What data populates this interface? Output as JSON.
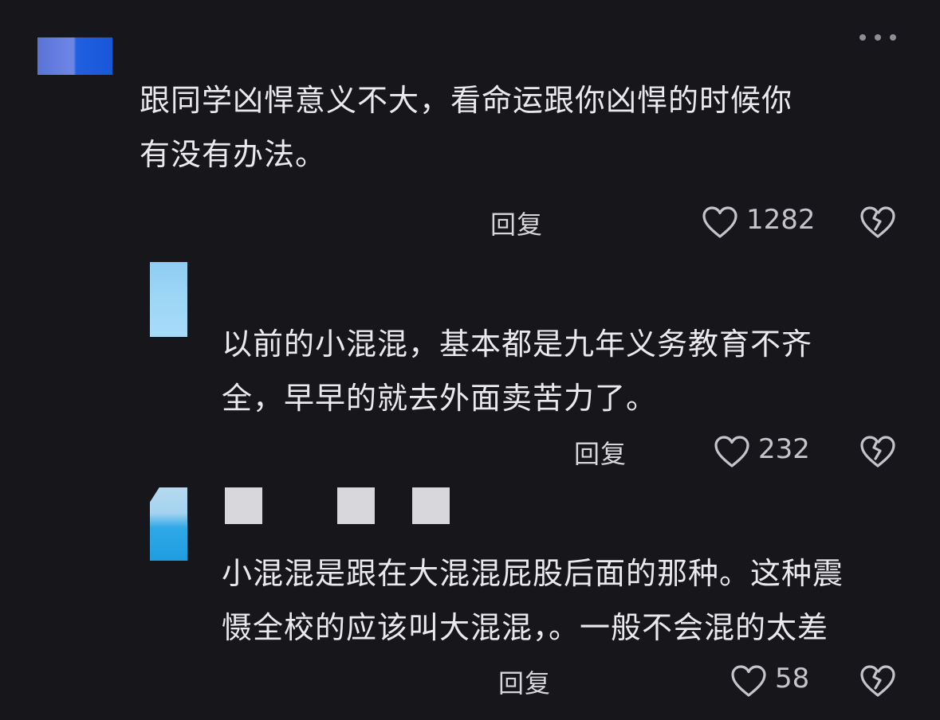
{
  "comments": [
    {
      "text_lines": [
        "跟同学凶悍意义不大，看命运跟你凶悍的时候你",
        "有没有办法。"
      ],
      "reply_label": "回复",
      "likes": "1282"
    },
    {
      "text_lines": [
        "以前的小混混，基本都是九年义务教育不齐",
        "全，早早的就去外面卖苦力了。"
      ],
      "reply_label": "回复",
      "likes": "232"
    },
    {
      "text_lines": [
        "小混混是跟在大混混屁股后面的那种。这种震",
        "慑全校的应该叫大混混，。一般不会混的太差"
      ],
      "reply_label": "回复",
      "likes": "58"
    }
  ],
  "icons": {
    "more": "more-horizontal-icon",
    "like": "heart-icon",
    "dislike": "broken-heart-icon"
  },
  "colors": {
    "background": "#17171b",
    "text": "#eaeaee",
    "secondary": "#c4c4ca"
  }
}
